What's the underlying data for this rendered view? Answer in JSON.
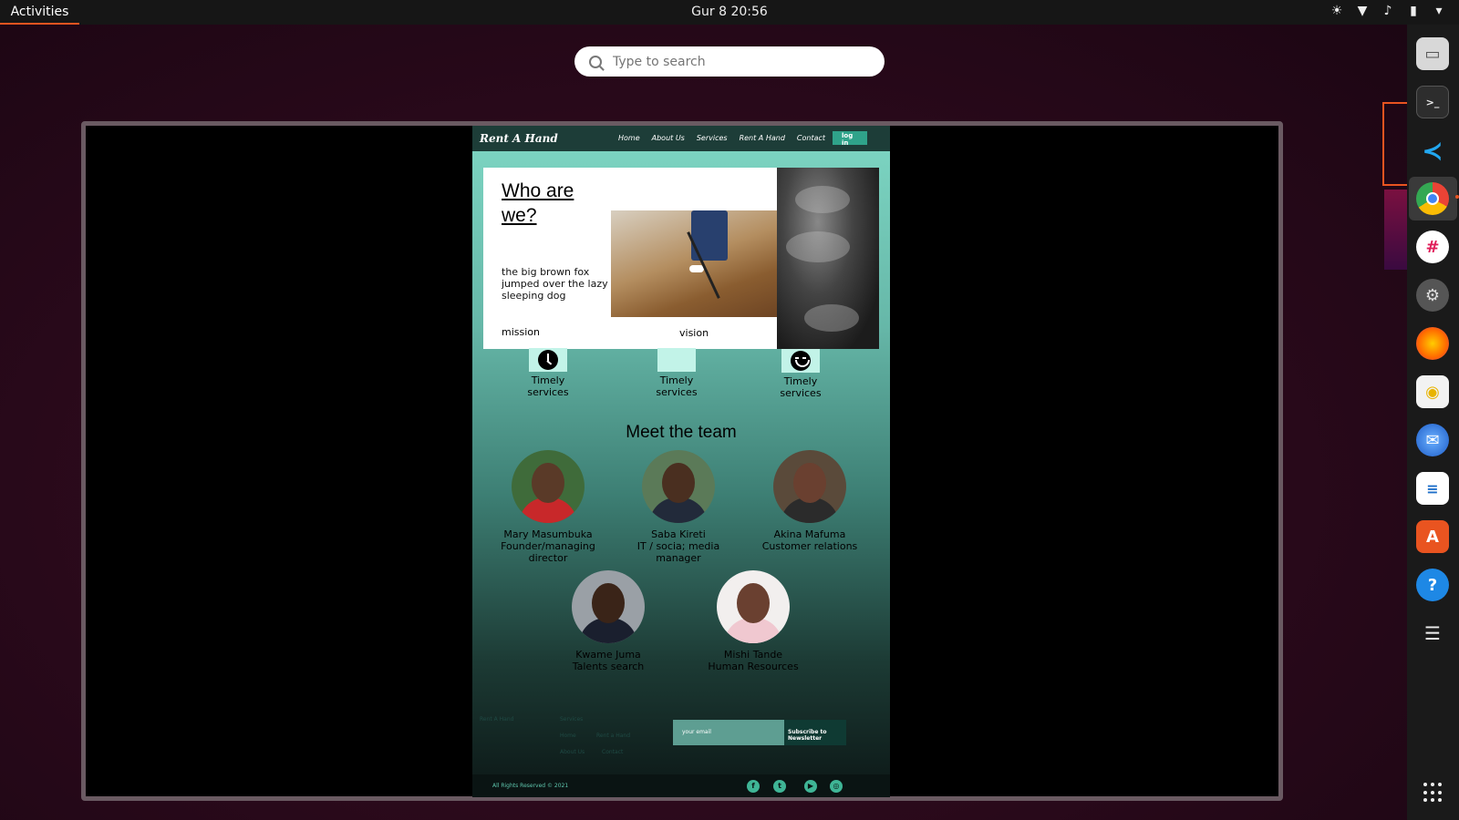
{
  "topbar": {
    "activities": "Activities",
    "clock": "Gur 8  20:56"
  },
  "search": {
    "placeholder": "Type to search"
  },
  "site": {
    "brand": "Rent A Hand",
    "nav": [
      "Home",
      "About Us",
      "Services",
      "Rent A Hand",
      "Contact"
    ],
    "login": "log in",
    "hero": {
      "title": "Who are we?",
      "tagline": "the big brown fox jumped over the lazy sleeping dog",
      "mission": "mission",
      "vision": "vision"
    },
    "features": [
      {
        "label": "Timely services",
        "icon": "clock-icon"
      },
      {
        "label": "Timely services",
        "icon": "blank-icon"
      },
      {
        "label": "Timely services",
        "icon": "smile-icon"
      }
    ],
    "team_title": "Meet the team",
    "team": [
      {
        "name": "Mary Masumbuka",
        "role": "Founder/managing director"
      },
      {
        "name": "Saba Kireti",
        "role": "IT / socia; media manager"
      },
      {
        "name": "Akina Mafuma",
        "role": "Customer relations"
      },
      {
        "name": "Kwame Juma",
        "role": "Talents search"
      },
      {
        "name": "Mishi Tande",
        "role": "Human Resources"
      }
    ],
    "footer": {
      "email_placeholder": "your email",
      "subscribe": "Subscribe to Newsletter",
      "rights": "All Rights Reserved © 2021",
      "faint_brand": "Rent A Hand",
      "faint_links": [
        "Services",
        "Home",
        "Rent a Hand",
        "About Us",
        "Contact"
      ],
      "social": [
        "facebook-icon",
        "twitter-icon",
        "youtube-icon",
        "instagram-icon"
      ]
    }
  },
  "dock": [
    "files-icon",
    "terminal-icon",
    "vscode-icon",
    "chrome-icon",
    "slack-icon",
    "settings-icon",
    "firefox-icon",
    "rhythmbox-icon",
    "thunderbird-icon",
    "writer-icon",
    "software-icon",
    "help-icon",
    "tweaks-icon",
    "show-apps-icon"
  ],
  "colors": {
    "accent": "#e95420",
    "site_teal": "#7ed7c4",
    "nav": "#1d3d38"
  }
}
